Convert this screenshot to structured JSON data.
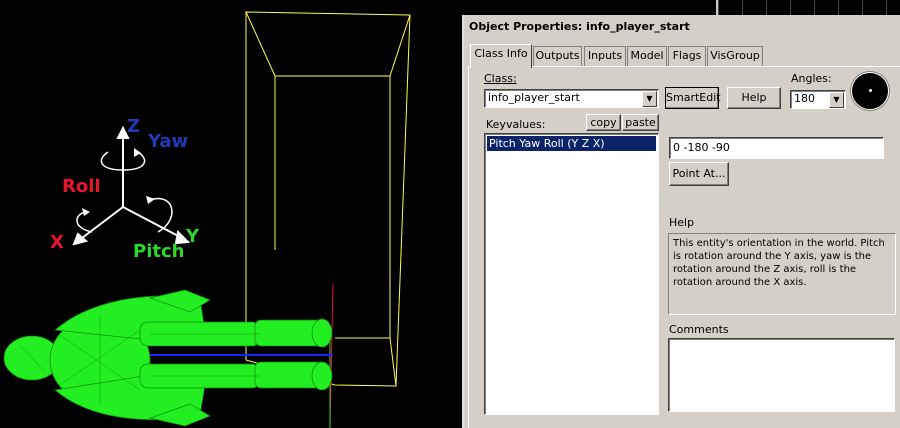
{
  "viewport": {
    "axis_labels": {
      "z": "Z",
      "yaw": "Yaw",
      "roll": "Roll",
      "x": "X",
      "pitch": "Pitch",
      "y": "Y"
    },
    "colors": {
      "yaw": "#1f3bb3",
      "roll": "#e8142c",
      "x": "#e8142c",
      "pitch": "#2bd82b",
      "y": "#2bd82b",
      "model": "#22ee22",
      "bbox": "#ffff44"
    }
  },
  "dialog": {
    "title": "Object Properties: info_player_start",
    "tabs": [
      "Class Info",
      "Outputs",
      "Inputs",
      "Model",
      "Flags",
      "VisGroup"
    ],
    "active_tab": "Class Info",
    "class_label": "Class:",
    "class_value": "info_player_start",
    "smartedit_label": "SmartEdit",
    "help_button_label": "Help",
    "angles_label": "Angles:",
    "angles_value": "180",
    "keyvalues_label": "Keyvalues:",
    "copy_label": "copy",
    "paste_label": "paste",
    "keyvalues": [
      {
        "name": "Pitch Yaw Roll (Y Z X)",
        "selected": true
      }
    ],
    "value_field": "0 -180 -90",
    "point_at_label": "Point At...",
    "help_section_label": "Help",
    "help_text": "This entity's orientation in the world. Pitch is rotation around the Y axis, yaw is the rotation around the Z axis, roll is the rotation around the X axis.",
    "comments_label": "Comments",
    "comments_value": ""
  }
}
